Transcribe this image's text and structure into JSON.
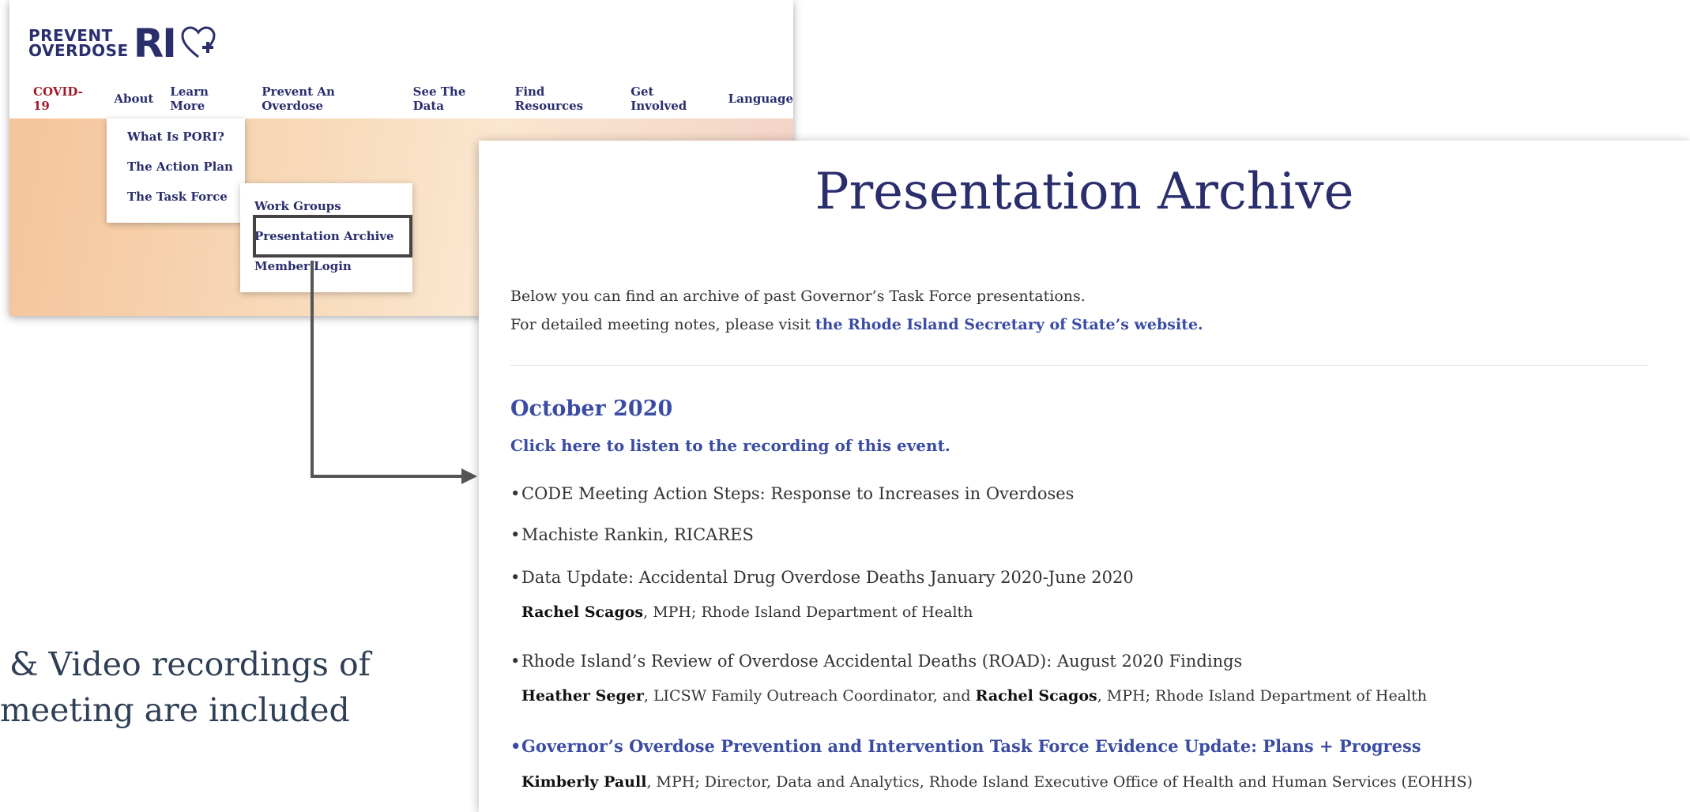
{
  "site": {
    "logo": {
      "line1": "PREVENT",
      "line2": "OVERDOSE",
      "ri": "RI"
    },
    "nav": [
      "COVID-19",
      "About",
      "Learn More",
      "Prevent An Overdose",
      "See The Data",
      "Find Resources",
      "Get Involved",
      "Language"
    ],
    "about_menu": [
      "What Is PORI?",
      "The Action Plan",
      "The Task Force"
    ],
    "task_force_menu": [
      "Work Groups",
      "Presentation Archive",
      "Member Login"
    ]
  },
  "caption": {
    "line1": "& Video recordings of",
    "line2": "meeting are included"
  },
  "archive": {
    "title": "Presentation Archive",
    "intro1": "Below you can find an archive of past Governor’s Task Force presentations.",
    "intro2_prefix": "For detailed meeting notes, please visit ",
    "intro2_link": "the Rhode Island Secretary of State’s website.",
    "month": "October 2020",
    "listen_link": "Click here to listen to the recording of this event.",
    "items": [
      "CODE Meeting Action Steps: Response to Increases in Overdoses",
      "Machiste Rankin, RICARES",
      "Data Update: Accidental Drug Overdose Deaths January 2020-June 2020",
      "Rhode Island’s Review of Overdose Accidental Deaths (ROAD): August 2020 Findings",
      "Governor’s Overdose Prevention and Intervention Task Force Evidence Update: Plans + Progress"
    ],
    "sub_data_update": {
      "name": "Rachel Scagos",
      "rest": ", MPH; Rhode Island Department of Health"
    },
    "sub_road": {
      "name1": "Heather Seger",
      "mid": ", LICSW Family Outreach Coordinator, and ",
      "name2": "Rachel Scagos",
      "rest": ", MPH; Rhode Island Department of Health"
    },
    "sub_evidence": {
      "name": "Kimberly Paull",
      "rest": ", MPH; Director, Data and Analytics, Rhode Island Executive Office of Health and Human Services (EOHHS)"
    }
  },
  "colors": {
    "navy": "#2a2e6d",
    "link_blue": "#3a4ca3",
    "covid_red": "#a01c2a"
  }
}
